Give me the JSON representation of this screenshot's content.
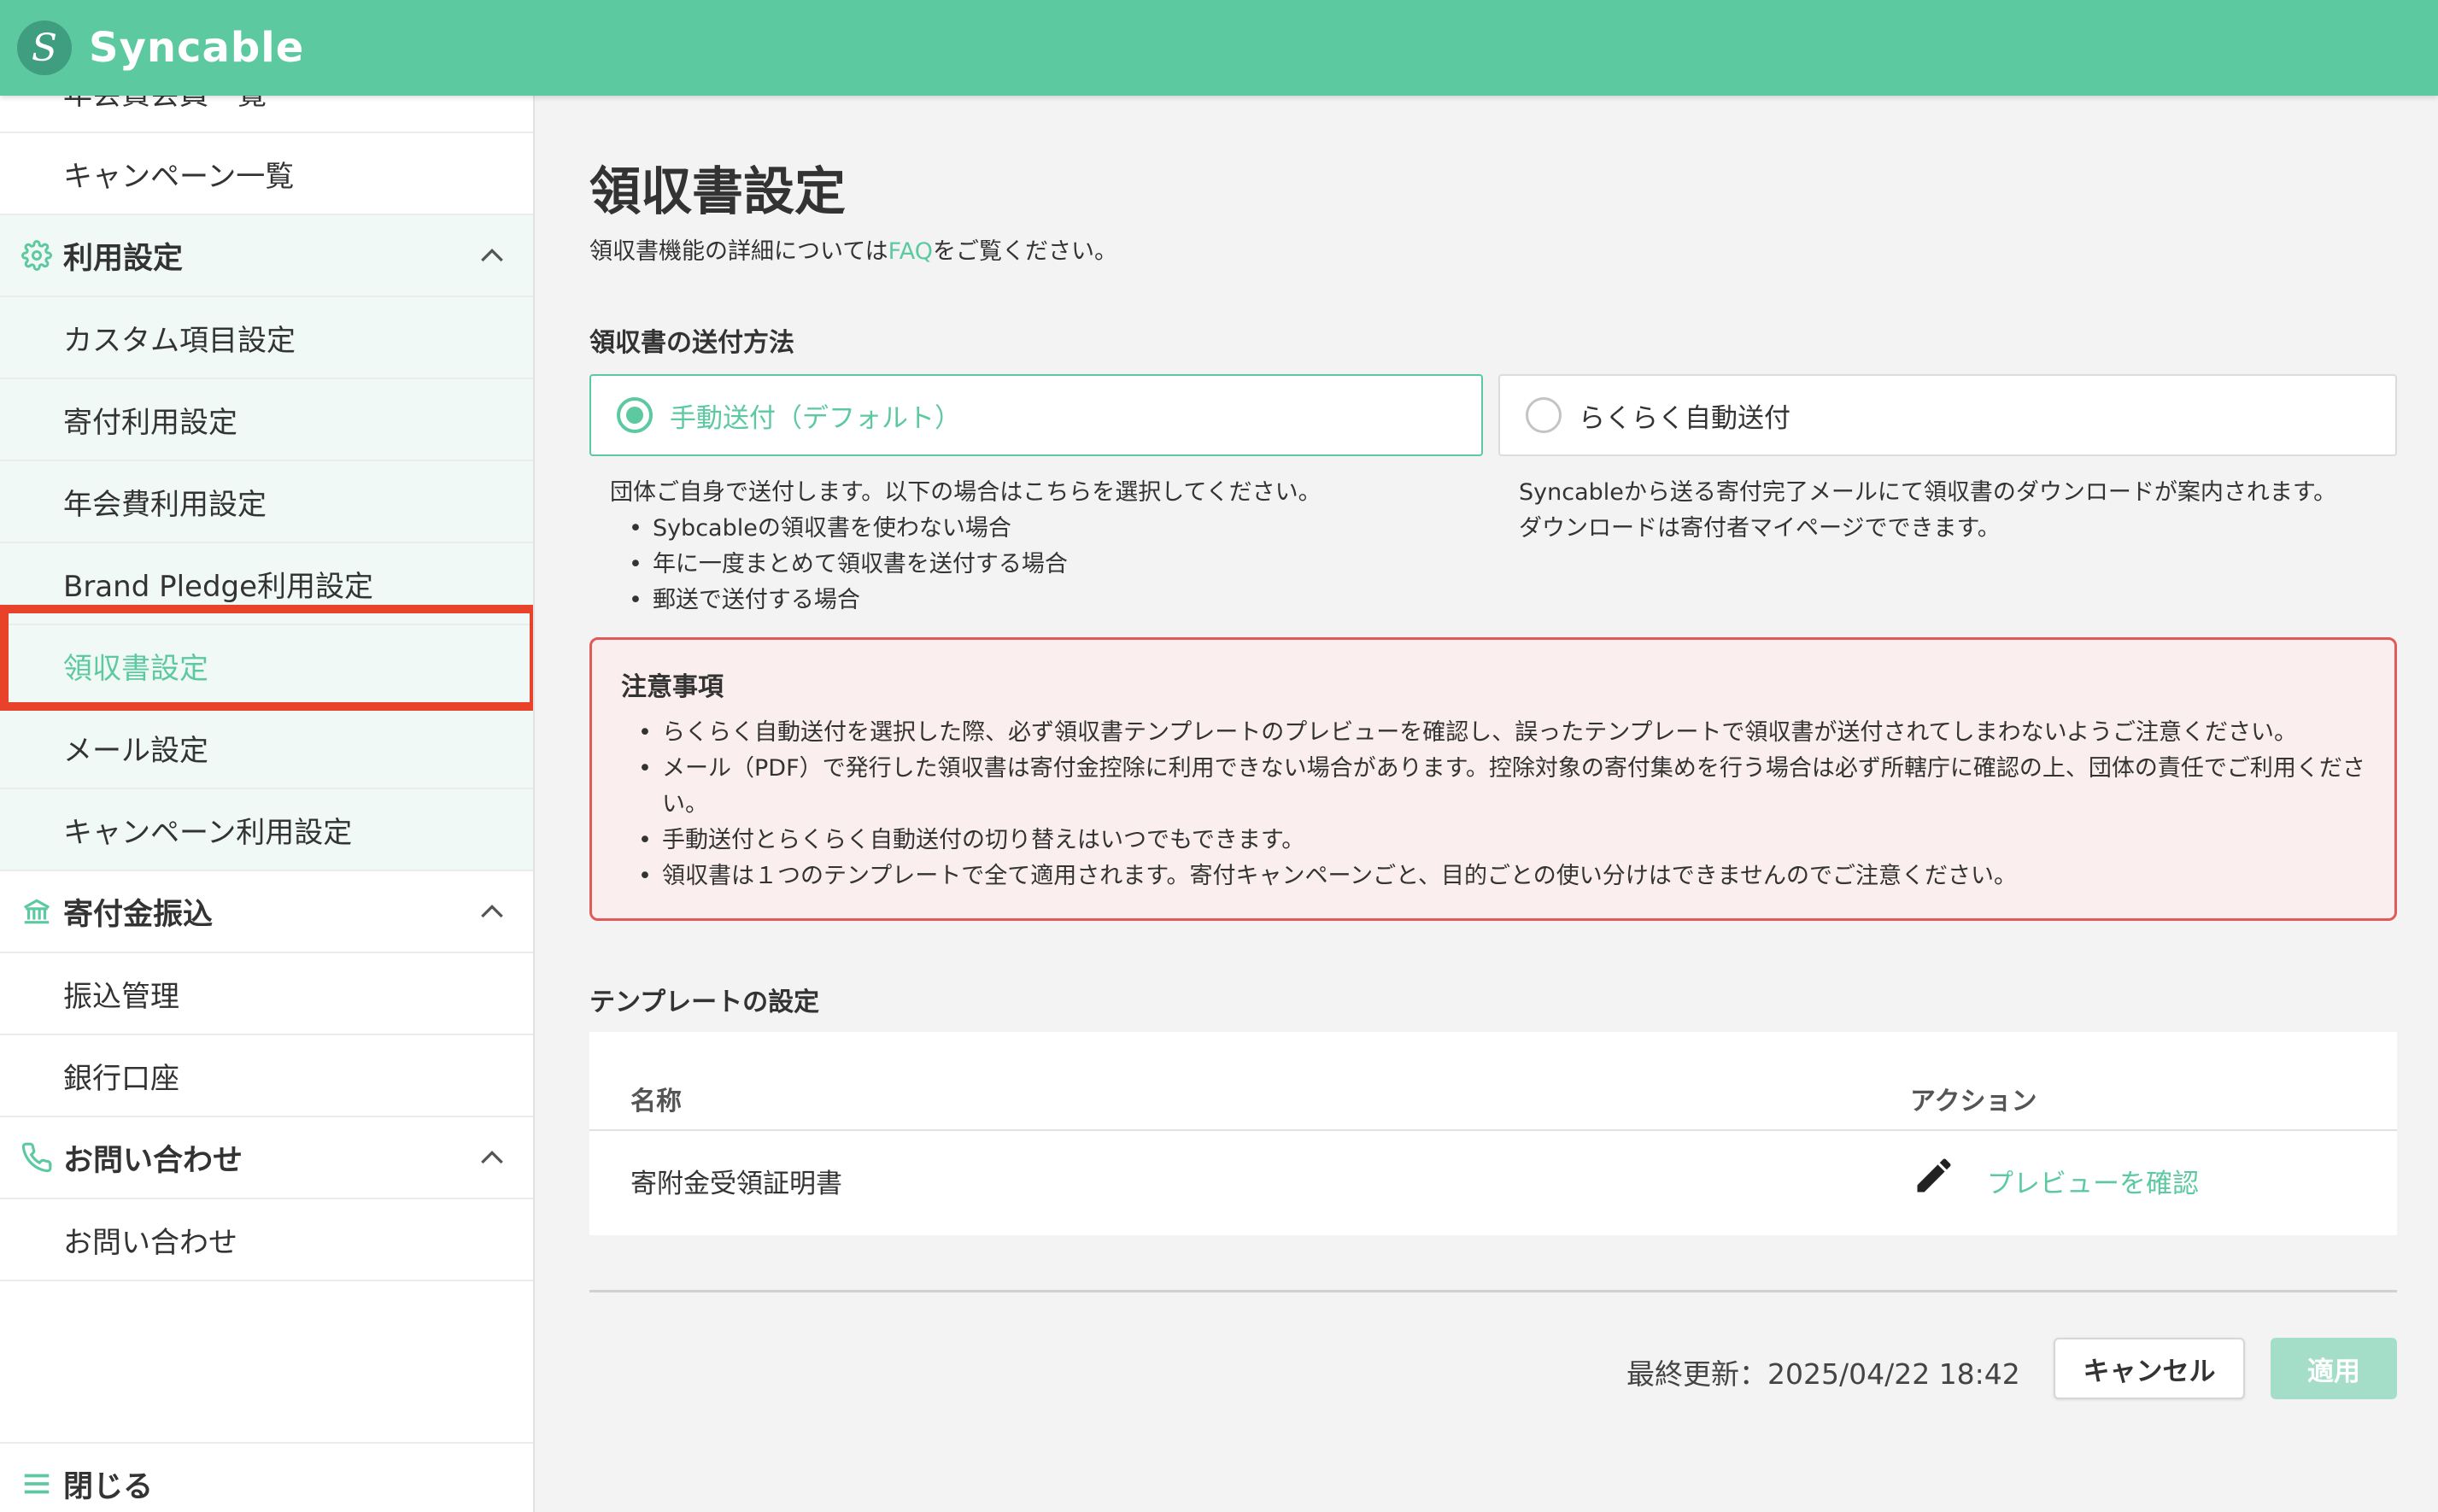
{
  "app": {
    "name": "Syncable",
    "logo_letter": "S"
  },
  "sidebar": {
    "partial_item": "年会費会員一覧",
    "items_top": [
      {
        "label": "キャンペーン一覧"
      }
    ],
    "usage_section": {
      "title": "利用設定",
      "icon": "gear-icon",
      "items": [
        {
          "label": "カスタム項目設定"
        },
        {
          "label": "寄付利用設定"
        },
        {
          "label": "年会費利用設定"
        },
        {
          "label": "Brand Pledge利用設定"
        },
        {
          "label": "領収書設定",
          "active": true
        },
        {
          "label": "メール設定"
        },
        {
          "label": "キャンペーン利用設定"
        }
      ]
    },
    "transfer_section": {
      "title": "寄付金振込",
      "icon": "bank-icon",
      "items": [
        {
          "label": "振込管理"
        },
        {
          "label": "銀行口座"
        }
      ]
    },
    "contact_section": {
      "title": "お問い合わせ",
      "icon": "phone-icon",
      "items": [
        {
          "label": "お問い合わせ"
        }
      ]
    },
    "close_label": "閉じる"
  },
  "main": {
    "title": "領収書設定",
    "subtitle_before": "領収書機能の詳細については",
    "subtitle_link": "FAQ",
    "subtitle_after": "をご覧ください。",
    "delivery": {
      "label": "領収書の送付方法",
      "options": [
        {
          "label": "手動送付（デフォルト）",
          "selected": true,
          "description": "団体ご自身で送付します。以下の場合はこちらを選択してください。",
          "bullets": [
            "Sybcableの領収書を使わない場合",
            "年に一度まとめて領収書を送付する場合",
            "郵送で送付する場合"
          ]
        },
        {
          "label": "らくらく自動送付",
          "selected": false,
          "description_lines": [
            "Syncableから送る寄付完了メールにて領収書のダウンロードが案内されます。",
            "ダウンロードは寄付者マイページでできます。"
          ]
        }
      ]
    },
    "notice": {
      "title": "注意事項",
      "items": [
        "らくらく自動送付を選択した際、必ず領収書テンプレートのプレビューを確認し、誤ったテンプレートで領収書が送付されてしまわないようご注意ください。",
        "メール（PDF）で発行した領収書は寄付金控除に利用できない場合があります。控除対象の寄付集めを行う場合は必ず所轄庁に確認の上、団体の責任でご利用ください。",
        "手動送付とらくらく自動送付の切り替えはいつでもできます。",
        "領収書は１つのテンプレートで全て適用されます。寄付キャンペーンごと、目的ごとの使い分けはできませんのでご注意ください。"
      ]
    },
    "template": {
      "label": "テンプレートの設定",
      "columns": [
        "名称",
        "アクション"
      ],
      "rows": [
        {
          "name": "寄附金受領証明書",
          "action_label": "プレビューを確認"
        }
      ]
    },
    "footer": {
      "last_updated": "最終更新：2025/04/22 18:42",
      "cancel_label": "キャンセル",
      "apply_label": "適用"
    }
  },
  "colors": {
    "brand": "#5cc9a1",
    "highlight": "#e8432a",
    "notice_border": "#e05a5a",
    "notice_bg": "#fbeeee"
  }
}
